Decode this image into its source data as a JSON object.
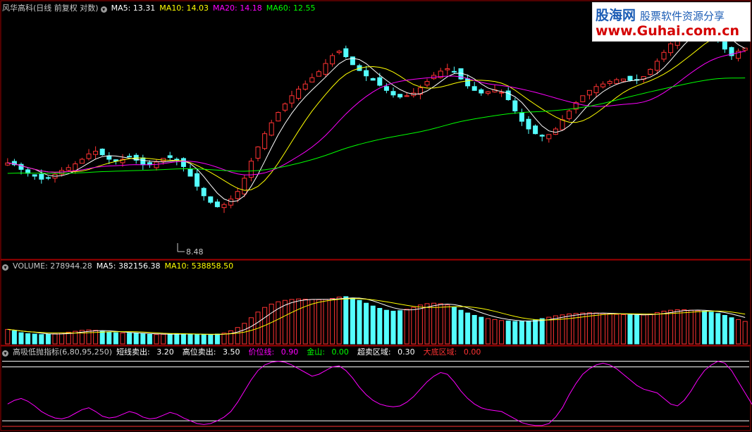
{
  "colors": {
    "background": "#000000",
    "up": "#ff3232",
    "down": "#54ffff",
    "ma5": "#ffffff",
    "ma10": "#ffff00",
    "ma20": "#ff00ff",
    "ma60": "#00ff00",
    "panel_border": "#a00000",
    "text": "#c8c8c8"
  },
  "watermark": {
    "brand": "股海网",
    "desc": "股票软件资源分享",
    "url": "www.Guhai.com.cn"
  },
  "price_panel": {
    "title": "风华高科(日线 前复权 对数)",
    "ma5_label": "MA5: 13.31",
    "ma10_label": "MA10: 14.03",
    "ma20_label": "MA20: 14.18",
    "ma60_label": "MA60: 12.55",
    "low_label": "8.48"
  },
  "volume_panel": {
    "vol_label": "VOLUME: 278944.28",
    "ma5_label": "MA5: 382156.38",
    "ma10_label": "MA10: 538858.50"
  },
  "indicator_panel": {
    "title": "高吸低抛指标(6,80,95,250)",
    "l1_label": "短线卖出:",
    "l1_value": "3.20",
    "l2_label": "高位卖出:",
    "l2_value": "3.50",
    "l3_label": "价位线:",
    "l3_value": "0.90",
    "l4_label": "金山:",
    "l4_value": "0.00",
    "l5_label": "超卖区域:",
    "l5_value": "0.30",
    "l6_label": "大底区域:",
    "l6_value": "0.00"
  },
  "chart_data": {
    "type": "candlestick",
    "price_ylim": [
      7.6,
      23.0
    ],
    "volume_ylim": [
      0,
      1550000
    ],
    "indicator_ylim": [
      0,
      3.6
    ],
    "indicator_levels": [
      3.5,
      3.2,
      0.3,
      0.0
    ],
    "closes": [
      11.4,
      11.3,
      11.05,
      10.85,
      10.7,
      10.55,
      10.6,
      10.8,
      11.0,
      11.15,
      11.35,
      11.6,
      11.9,
      12.05,
      11.85,
      11.6,
      11.5,
      11.6,
      11.75,
      11.55,
      11.3,
      11.3,
      11.45,
      11.65,
      11.7,
      11.55,
      11.2,
      10.7,
      10.2,
      9.75,
      9.45,
      9.25,
      9.35,
      9.6,
      9.95,
      10.6,
      11.5,
      12.3,
      13.1,
      13.8,
      14.5,
      15.1,
      15.7,
      16.2,
      16.6,
      17.1,
      17.6,
      18.3,
      19.0,
      19.4,
      18.9,
      18.2,
      17.7,
      17.25,
      16.9,
      16.5,
      16.1,
      15.75,
      15.6,
      15.7,
      15.9,
      16.3,
      16.8,
      17.3,
      17.65,
      17.85,
      17.6,
      17.0,
      16.45,
      16.1,
      15.9,
      16.0,
      16.15,
      15.95,
      15.4,
      14.6,
      13.9,
      13.4,
      13.1,
      12.95,
      13.05,
      13.4,
      14.0,
      14.6,
      15.2,
      15.7,
      16.1,
      16.4,
      16.6,
      16.8,
      16.95,
      17.0,
      16.9,
      16.9,
      17.2,
      17.8,
      18.5,
      19.3,
      20.1,
      20.8,
      21.4,
      21.7,
      21.9,
      22.0,
      21.5,
      20.6,
      19.6,
      19.0,
      19.4,
      19.7
    ],
    "volumes": [
      310000,
      280000,
      240000,
      220000,
      210000,
      200000,
      205000,
      215000,
      230000,
      250000,
      270000,
      290000,
      300000,
      290000,
      270000,
      250000,
      240000,
      235000,
      230000,
      225000,
      215000,
      205000,
      200000,
      205000,
      215000,
      220000,
      215000,
      205000,
      200000,
      195000,
      200000,
      210000,
      230000,
      280000,
      350000,
      440000,
      560000,
      680000,
      780000,
      850000,
      900000,
      930000,
      950000,
      960000,
      955000,
      950000,
      945000,
      950000,
      970000,
      1000000,
      1010000,
      980000,
      930000,
      870000,
      810000,
      760000,
      720000,
      700000,
      710000,
      740000,
      780000,
      830000,
      860000,
      870000,
      860000,
      830000,
      780000,
      720000,
      660000,
      610000,
      570000,
      540000,
      520000,
      500000,
      490000,
      480000,
      480000,
      490000,
      510000,
      540000,
      570000,
      600000,
      620000,
      640000,
      650000,
      660000,
      665000,
      660000,
      650000,
      640000,
      630000,
      625000,
      620000,
      615000,
      620000,
      640000,
      670000,
      700000,
      720000,
      730000,
      730000,
      720000,
      710000,
      700000,
      680000,
      650000,
      610000,
      560000,
      520000,
      480000
    ],
    "indicator": [
      1.2,
      1.4,
      1.5,
      1.35,
      1.1,
      0.8,
      0.6,
      0.45,
      0.4,
      0.5,
      0.7,
      0.9,
      1.0,
      0.8,
      0.55,
      0.45,
      0.5,
      0.65,
      0.8,
      0.7,
      0.5,
      0.4,
      0.45,
      0.6,
      0.75,
      0.65,
      0.45,
      0.3,
      0.15,
      0.1,
      0.15,
      0.3,
      0.5,
      0.8,
      1.3,
      1.9,
      2.5,
      3.0,
      3.3,
      3.45,
      3.5,
      3.45,
      3.3,
      3.1,
      2.9,
      2.7,
      2.8,
      3.0,
      3.2,
      3.25,
      3.0,
      2.6,
      2.1,
      1.7,
      1.4,
      1.2,
      1.1,
      1.05,
      1.1,
      1.3,
      1.6,
      2.0,
      2.4,
      2.7,
      2.9,
      2.8,
      2.4,
      1.9,
      1.5,
      1.2,
      1.0,
      0.9,
      0.85,
      0.8,
      0.6,
      0.4,
      0.2,
      0.1,
      0.05,
      0.05,
      0.15,
      0.5,
      1.0,
      1.7,
      2.3,
      2.8,
      3.1,
      3.3,
      3.4,
      3.3,
      3.1,
      2.8,
      2.5,
      2.2,
      2.0,
      1.9,
      1.8,
      1.5,
      1.2,
      1.1,
      1.4,
      1.9,
      2.5,
      3.0,
      3.3,
      3.5,
      3.4,
      3.0,
      2.4,
      1.8,
      1.2,
      0.7,
      0.4,
      0.25,
      0.2,
      0.3
    ]
  }
}
